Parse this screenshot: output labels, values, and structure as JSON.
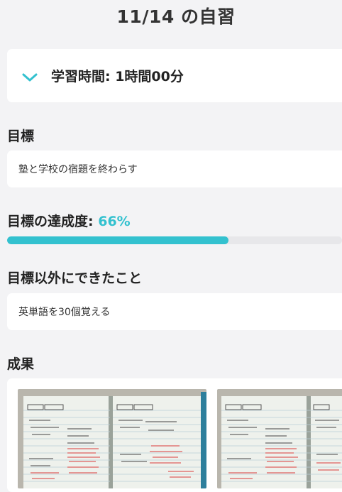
{
  "header": {
    "title": "11/14 の自習"
  },
  "study_time": {
    "label": "学習時間: 1時間00分",
    "expanded": false
  },
  "goal": {
    "heading": "目標",
    "text": "塾と学校の宿題を終わらす"
  },
  "achievement": {
    "heading": "目標の達成度: ",
    "percent_label": "66%",
    "progress": 0.66
  },
  "other": {
    "heading": "目標以外にできたこと",
    "text": "英単語を30個覚える"
  },
  "results": {
    "heading": "成果",
    "photos": [
      {
        "name": "notebook-photo-1"
      },
      {
        "name": "notebook-photo-2"
      }
    ]
  },
  "colors": {
    "accent": "#33c1cf",
    "background": "#f3f3f5",
    "card": "#ffffff"
  }
}
